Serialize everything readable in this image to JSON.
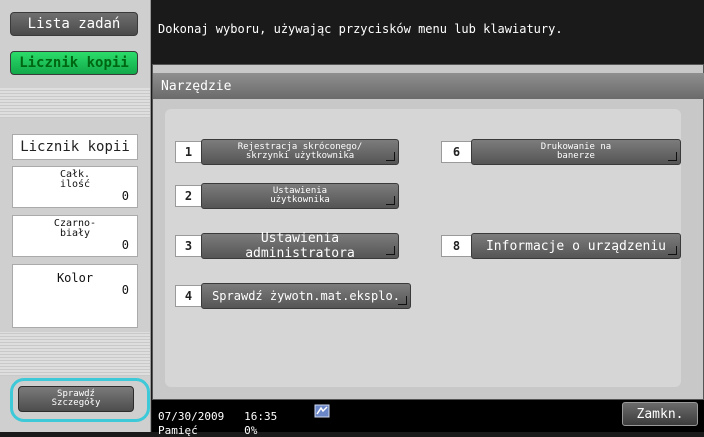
{
  "sidebar": {
    "job_list_button": "Lista zadań",
    "counter_button": "Licznik kopii",
    "section_title": "Licznik kopii",
    "total": {
      "label": "Całk.\nilość",
      "value": "0"
    },
    "bw": {
      "label": "Czarno-\nbiały",
      "value": "0"
    },
    "color": {
      "label": "Kolor",
      "value": "0"
    },
    "details_button": "Sprawdź\nSzczegóły",
    "accent_color": "#18c455",
    "highlight_ring_color": "#3ec9d9"
  },
  "message": "Dokonaj wyboru, używając przycisków menu lub klawiatury.",
  "panel": {
    "title": "Narzędzie",
    "items": [
      {
        "num": "1",
        "label": "Rejestracja skróconego/\nskrzynki użytkownika"
      },
      {
        "num": "2",
        "label": "Ustawienia\nużytkownika"
      },
      {
        "num": "3",
        "label": "Ustawienia administratora"
      },
      {
        "num": "4",
        "label": "Sprawdź żywotn.mat.eksplo."
      },
      {
        "num": "6",
        "label": "Drukowanie na\nbanerze"
      },
      {
        "num": "8",
        "label": "Informacje o urządzeniu"
      }
    ]
  },
  "footer": {
    "date": "07/30/2009",
    "time": "16:35",
    "memory_label": "Pamięć",
    "memory_value": "0%",
    "close_button": "Zamkn.",
    "network_icon": "network-icon"
  }
}
